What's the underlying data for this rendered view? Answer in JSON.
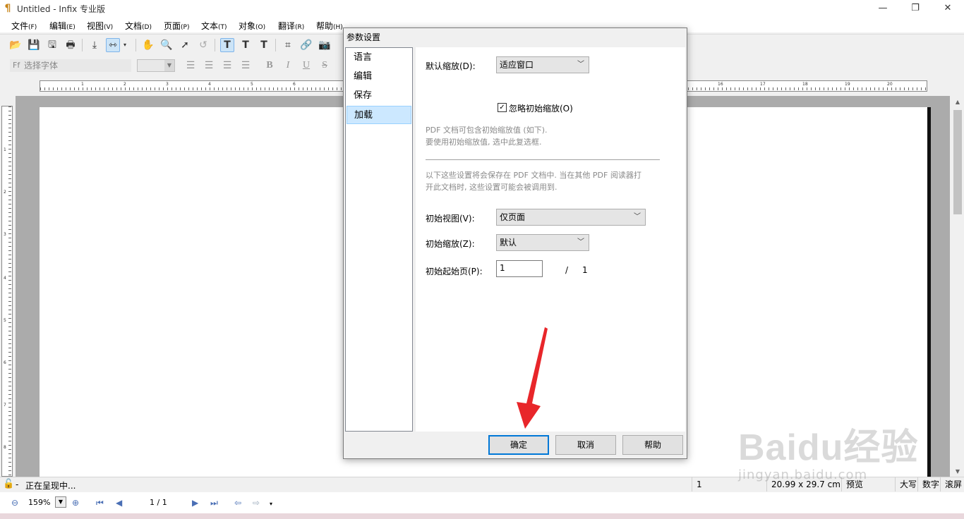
{
  "window": {
    "title": "Untitled - Infix 专业版"
  },
  "menu": [
    {
      "label": "文件",
      "key": "(F)"
    },
    {
      "label": "编辑",
      "key": "(E)"
    },
    {
      "label": "视图",
      "key": "(V)"
    },
    {
      "label": "文档",
      "key": "(D)"
    },
    {
      "label": "页面",
      "key": "(P)"
    },
    {
      "label": "文本",
      "key": "(T)"
    },
    {
      "label": "对象",
      "key": "(O)"
    },
    {
      "label": "翻译",
      "key": "(R)"
    },
    {
      "label": "帮助",
      "key": "(H)"
    }
  ],
  "format_toolbar": {
    "font_placeholder": "选择字体",
    "font_icon": "Ff",
    "bold": "B",
    "italic": "I",
    "underline": "U",
    "strike": "S"
  },
  "ruler_numbers_h": [
    "1",
    "2",
    "3",
    "4",
    "5",
    "6",
    "16",
    "17",
    "18",
    "19",
    "20"
  ],
  "ruler_numbers_v": [
    "1",
    "2",
    "3",
    "4",
    "5",
    "6",
    "7",
    "8"
  ],
  "dialog": {
    "title": "参数设置",
    "categories": [
      "语言",
      "编辑",
      "保存",
      "加载"
    ],
    "selected_category": "加载",
    "default_zoom_label": "默认缩放(D):",
    "default_zoom_value": "适应窗口",
    "ignore_initial_zoom_label": "忽略初始缩放(O)",
    "ignore_initial_zoom_checked": true,
    "hint1_line1": "PDF 文档可包含初始缩放值 (如下).",
    "hint1_line2": "要使用初始缩放值, 选中此复选框.",
    "hint2_line1": "以下这些设置将会保存在 PDF 文档中. 当在其他 PDF 阅读器打",
    "hint2_line2": "开此文档时, 这些设置可能会被调用到.",
    "initial_view_label": "初始视图(V):",
    "initial_view_value": "仅页面",
    "initial_zoom_label": "初始缩放(Z):",
    "initial_zoom_value": "默认",
    "start_page_label": "初始起始页(P):",
    "start_page_value": "1",
    "page_separator": "/",
    "total_pages": "1",
    "ok": "确定",
    "cancel": "取消",
    "help": "帮助"
  },
  "status": {
    "message": "正在呈现中...",
    "page": "1",
    "size": "20.99 x 29.7 cm",
    "mode": "预览",
    "caps": "大写",
    "num": "数字",
    "scroll": "滚屏"
  },
  "nav": {
    "zoom": "159%",
    "page": "1 / 1"
  },
  "watermark": {
    "text": "Baidu经验",
    "sub": "jingyan.baidu.com"
  },
  "colors": {
    "accent": "#0078d7",
    "selected": "#cce8ff",
    "arrow": "#e8262a"
  }
}
